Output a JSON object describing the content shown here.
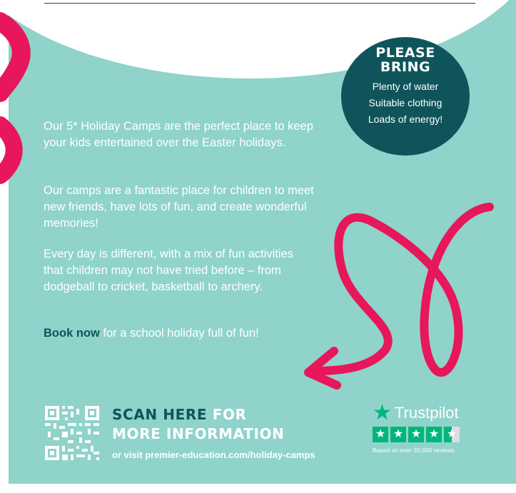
{
  "please_bring": {
    "title_line1": "PLEASE",
    "title_line2": "BRING",
    "items": [
      "Plenty of water",
      "Suitable clothing",
      "Loads of energy!"
    ]
  },
  "body": {
    "p1": "Our 5* Holiday Camps are the perfect place to keep your kids entertained over the Easter holidays.",
    "p2": "Our camps are a fantastic place for children to meet new friends, have lots of fun, and create wonderful memories!",
    "p3": "Every day is different, with a mix of fun activities that children may not have tried before – from dodgeball to cricket, basketball to archery.",
    "book_now": "Book now",
    "p4_rest": " for a school holiday full of fun!"
  },
  "scan": {
    "word1": "SCAN HERE",
    "word2": " FOR",
    "line2": "MORE INFORMATION",
    "visit": "or visit premier-education.com/holiday-camps"
  },
  "trustpilot": {
    "name": "Trustpilot",
    "rating_stars": 4.5,
    "reviews": "Based on over 20,000 reviews"
  },
  "colors": {
    "teal": "#8fd3cb",
    "dark_teal": "#0f545b",
    "pink": "#e8165a",
    "trustpilot_green": "#00b67a"
  },
  "icons": [
    "qr-code-icon",
    "trustpilot-star-icon",
    "pink-arrow-decoration"
  ]
}
